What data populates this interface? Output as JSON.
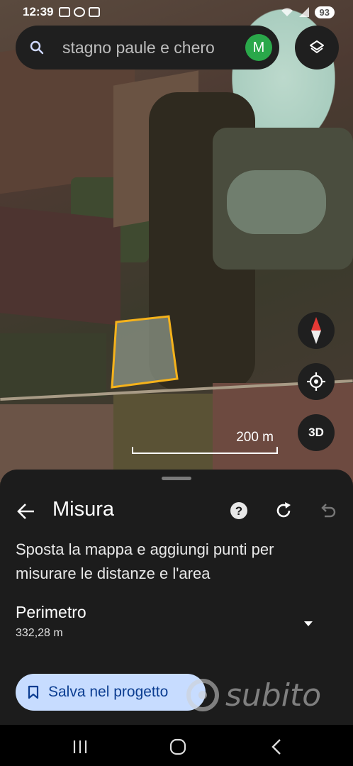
{
  "status_bar": {
    "time": "12:39",
    "battery": "93",
    "icons": [
      "screenshot-icon",
      "whatsapp-icon",
      "app-icon"
    ]
  },
  "search": {
    "text": "stagno paule e chero",
    "avatar_initial": "M"
  },
  "map": {
    "scale_label": "200 m",
    "three_d_label": "3D",
    "polygon_color": "#f5b21b"
  },
  "sheet": {
    "title": "Misura",
    "instructions": "Sposta la mappa e aggiungi punti per misurare le distanze e l'area",
    "perimeter_label": "Perimetro",
    "perimeter_value": "332,28 m",
    "save_label": "Salva nel progetto"
  },
  "watermark": {
    "text": "subito"
  },
  "colors": {
    "accent_button": "#c7dcff",
    "avatar": "#2aa84a",
    "compass_red": "#e53935"
  }
}
